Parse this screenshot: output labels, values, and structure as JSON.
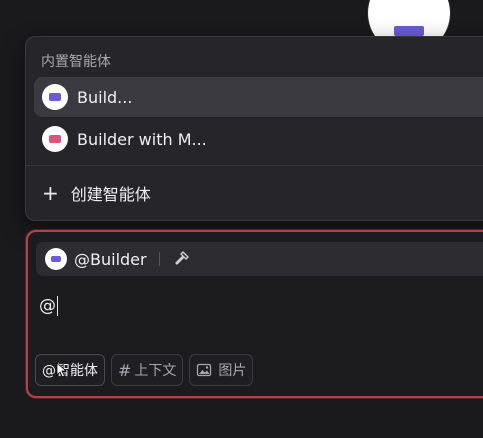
{
  "dropdown": {
    "section_title": "内置智能体",
    "items": [
      {
        "label": "Build...",
        "icon": "agent-avatar-icon",
        "accent": "#6b5bd6",
        "selected": true
      },
      {
        "label": "Builder with M...",
        "icon": "agent-avatar-icon",
        "accent": "#e0517a",
        "selected": false
      }
    ],
    "create_label": "创建智能体"
  },
  "composer": {
    "agent_chip": {
      "name": "@Builder",
      "icon": "hammer-icon"
    },
    "input_value": "@",
    "tools": [
      {
        "label": "@智能体",
        "icon": "at-icon"
      },
      {
        "label": "上下文",
        "icon": "hash-icon"
      },
      {
        "label": "图片",
        "icon": "image-icon"
      }
    ]
  },
  "colors": {
    "background": "#1a1a1d",
    "panel": "#26262a",
    "composer_border": "#b0424e",
    "accent_purple": "#6b5bd6",
    "accent_pink": "#e0517a"
  }
}
